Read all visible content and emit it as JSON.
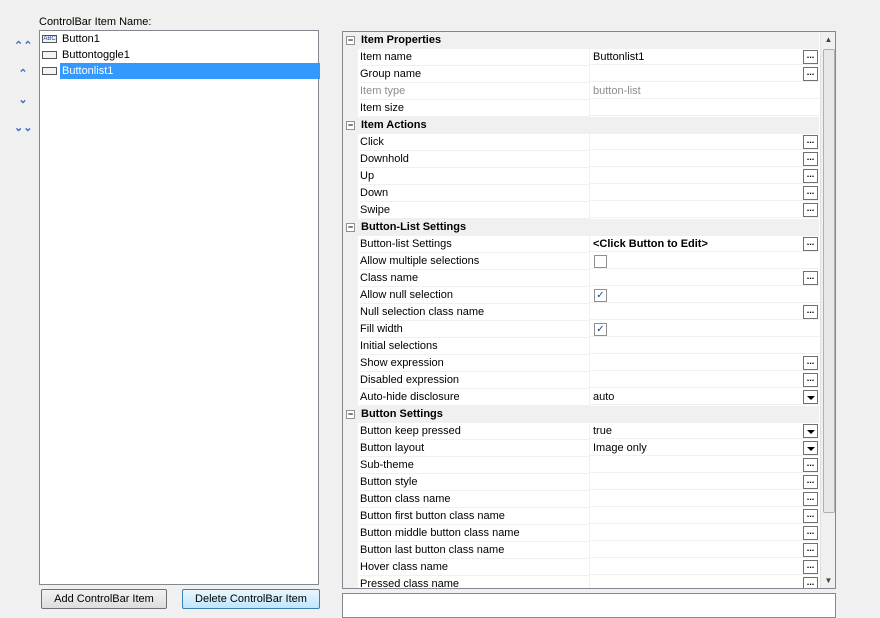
{
  "panel_title": "ControlBar Item Name:",
  "move_buttons": {
    "top": "⌃⌃",
    "up": "⌃",
    "down": "⌄",
    "bottom": "⌄⌄"
  },
  "items": [
    {
      "label": "Button1",
      "icon": "abc-icon",
      "icon_text": "ABC"
    },
    {
      "label": "Buttontoggle1",
      "icon": "toggle-icon",
      "icon_text": ""
    },
    {
      "label": "Buttonlist1",
      "icon": "list-icon",
      "icon_text": "",
      "selected": true
    }
  ],
  "buttons": {
    "add": "Add ControlBar Item",
    "delete": "Delete ControlBar Item"
  },
  "property_grid": {
    "rows": [
      {
        "type": "cat",
        "name": "Item Properties"
      },
      {
        "type": "prop",
        "name": "Item name",
        "value": "Buttonlist1",
        "editor": "ellipsis"
      },
      {
        "type": "prop",
        "name": "Group name",
        "value": "",
        "editor": "ellipsis"
      },
      {
        "type": "prop",
        "name": "Item type",
        "value": "button-list",
        "disabled": true
      },
      {
        "type": "prop",
        "name": "Item size",
        "value": ""
      },
      {
        "type": "cat",
        "name": "Item Actions"
      },
      {
        "type": "prop",
        "name": "Click",
        "value": "",
        "editor": "ellipsis"
      },
      {
        "type": "prop",
        "name": "Downhold",
        "value": "",
        "editor": "ellipsis"
      },
      {
        "type": "prop",
        "name": "Up",
        "value": "",
        "editor": "ellipsis"
      },
      {
        "type": "prop",
        "name": "Down",
        "value": "",
        "editor": "ellipsis"
      },
      {
        "type": "prop",
        "name": "Swipe",
        "value": "",
        "editor": "ellipsis"
      },
      {
        "type": "cat",
        "name": "Button-List Settings"
      },
      {
        "type": "prop",
        "name": "Button-list Settings",
        "value": "<Click Button to Edit>",
        "editor": "ellipsis",
        "bold": true
      },
      {
        "type": "prop",
        "name": "Allow multiple selections",
        "checkbox": false
      },
      {
        "type": "prop",
        "name": "Class name",
        "value": "",
        "editor": "ellipsis"
      },
      {
        "type": "prop",
        "name": "Allow null selection",
        "checkbox": true
      },
      {
        "type": "prop",
        "name": "Null selection class name",
        "value": "",
        "editor": "ellipsis"
      },
      {
        "type": "prop",
        "name": "Fill width",
        "checkbox": true
      },
      {
        "type": "prop",
        "name": "Initial selections",
        "value": ""
      },
      {
        "type": "prop",
        "name": "Show expression",
        "value": "",
        "editor": "ellipsis"
      },
      {
        "type": "prop",
        "name": "Disabled expression",
        "value": "",
        "editor": "ellipsis"
      },
      {
        "type": "prop",
        "name": "Auto-hide disclosure",
        "value": "auto",
        "editor": "dropdown"
      },
      {
        "type": "cat",
        "name": "Button Settings"
      },
      {
        "type": "prop",
        "name": "Button keep pressed",
        "value": "true",
        "editor": "dropdown"
      },
      {
        "type": "prop",
        "name": "Button layout",
        "value": "Image only",
        "editor": "dropdown"
      },
      {
        "type": "prop",
        "name": "Sub-theme",
        "value": "",
        "editor": "ellipsis"
      },
      {
        "type": "prop",
        "name": "Button style",
        "value": "",
        "editor": "ellipsis"
      },
      {
        "type": "prop",
        "name": "Button class name",
        "value": "",
        "editor": "ellipsis"
      },
      {
        "type": "prop",
        "name": "Button first button class name",
        "value": "",
        "editor": "ellipsis"
      },
      {
        "type": "prop",
        "name": "Button middle button class name",
        "value": "",
        "editor": "ellipsis"
      },
      {
        "type": "prop",
        "name": "Button last button class name",
        "value": "",
        "editor": "ellipsis"
      },
      {
        "type": "prop",
        "name": "Hover class name",
        "value": "",
        "editor": "ellipsis"
      },
      {
        "type": "prop",
        "name": "Pressed class name",
        "value": "",
        "editor": "ellipsis"
      }
    ]
  }
}
